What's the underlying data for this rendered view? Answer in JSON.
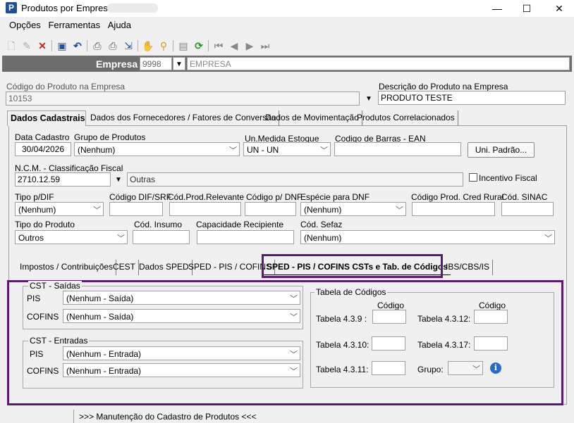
{
  "window": {
    "title": "Produtos por Empresa",
    "minimize": "—",
    "maximize": "☐",
    "close": "✕"
  },
  "menu": [
    "Opções",
    "Ferramentas",
    "Ajuda"
  ],
  "toolbar": {
    "icons": [
      "new-doc-icon",
      "edit-icon",
      "delete-icon",
      "save-icon",
      "undo-icon",
      "print-icon",
      "print-preview-icon",
      "export-icon",
      "hand-icon",
      "search-icon",
      "properties-icon",
      "refresh-icon",
      "first-icon",
      "prev-icon",
      "next-icon",
      "last-icon"
    ]
  },
  "empresa": {
    "label": "Empresa",
    "code": "9998",
    "name": "EMPRESA"
  },
  "produto": {
    "codigo_label": "Código do Produto na Empresa",
    "codigo": "10153",
    "descricao_label": "Descrição do Produto na Empresa",
    "descricao": "PRODUTO TESTE"
  },
  "main_tabs": [
    "Dados Cadastrais",
    "Dados dos Fornecedores / Fatores de Conversão",
    "Dados de Movimentação",
    "Produtos Correlacionados"
  ],
  "dados": {
    "data_cadastro_label": "Data Cadastro",
    "data_cadastro": "30/04/2026",
    "grupo_label": "Grupo de Produtos",
    "grupo": "(Nenhum)",
    "unmedida_label": "Un.Medida Estoque",
    "unmedida": "UN - UN",
    "ean_label": "Codigo de Barras - EAN",
    "ean": "",
    "uni_padrao_btn": "Uni. Padrão...",
    "ncm_label": "N.C.M. - Classificação Fiscal",
    "ncm": "2710.12.59",
    "ncm_desc": "Outras",
    "incentivo_label": "Incentivo Fiscal",
    "tipo_dif_label": "Tipo p/DIF",
    "tipo_dif": "(Nenhum)",
    "cod_dif_label": "Código DIF/SRF",
    "cod_relevante_label": "Cód.Prod.Relevante",
    "cod_dnf_label": "Código p/ DNF",
    "especie_dnf_label": "Espécie para DNF",
    "especie_dnf": "(Nenhum)",
    "cod_rural_label": "Código Prod. Cred Rural",
    "cod_sinac_label": "Cód. SINAC",
    "tipo_produto_label": "Tipo do Produto",
    "tipo_produto": "Outros",
    "cod_insumo_label": "Cód. Insumo",
    "capacidade_label": "Capacidade Recipiente",
    "cod_sefaz_label": "Cód. Sefaz",
    "cod_sefaz": "(Nenhum)"
  },
  "sub_tabs": [
    "Impostos / Contribuições",
    "CEST",
    "Dados SPED",
    "SPED - PIS / COFINS",
    "SPED - PIS / COFINS CSTs e Tab. de Códigos",
    "IBS/CBS/IS"
  ],
  "cst_saidas": {
    "title": "CST - Saídas",
    "pis_label": "PIS",
    "pis": "(Nenhum - Saída)",
    "cofins_label": "COFINS",
    "cofins": "(Nenhum - Saída)"
  },
  "cst_entradas": {
    "title": "CST - Entradas",
    "pis_label": "PIS",
    "pis": "(Nenhum - Entrada)",
    "cofins_label": "COFINS",
    "cofins": "(Nenhum - Entrada)"
  },
  "tabela": {
    "title": "Tabela de Códigos",
    "codigo_hdr": "Código",
    "t439": "Tabela 4.3.9 :",
    "t4312": "Tabela 4.3.12:",
    "t4310": "Tabela 4.3.10:",
    "t4317": "Tabela 4.3.17:",
    "t4311": "Tabela 4.3.11:",
    "grupo": "Grupo:"
  },
  "status": ">>> Manutenção do Cadastro de Produtos <<<",
  "colors": {
    "highlight": "#5a1a7a",
    "empresa_bar": "#6d6d6d",
    "info": "#2a6ac8"
  }
}
